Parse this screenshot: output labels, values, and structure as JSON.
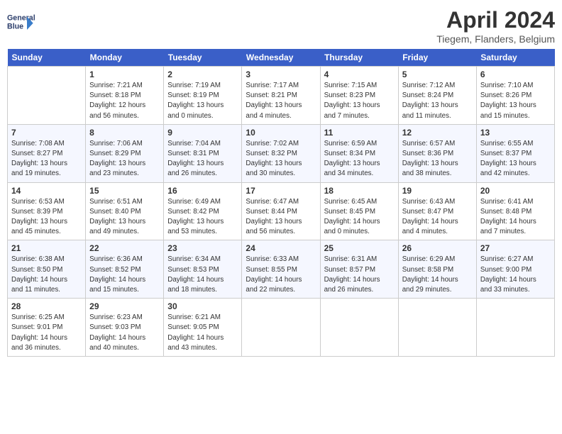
{
  "header": {
    "logo_line1": "General",
    "logo_line2": "Blue",
    "month_title": "April 2024",
    "location": "Tiegem, Flanders, Belgium"
  },
  "weekdays": [
    "Sunday",
    "Monday",
    "Tuesday",
    "Wednesday",
    "Thursday",
    "Friday",
    "Saturday"
  ],
  "weeks": [
    [
      {
        "day": "",
        "info": ""
      },
      {
        "day": "1",
        "info": "Sunrise: 7:21 AM\nSunset: 8:18 PM\nDaylight: 12 hours\nand 56 minutes."
      },
      {
        "day": "2",
        "info": "Sunrise: 7:19 AM\nSunset: 8:19 PM\nDaylight: 13 hours\nand 0 minutes."
      },
      {
        "day": "3",
        "info": "Sunrise: 7:17 AM\nSunset: 8:21 PM\nDaylight: 13 hours\nand 4 minutes."
      },
      {
        "day": "4",
        "info": "Sunrise: 7:15 AM\nSunset: 8:23 PM\nDaylight: 13 hours\nand 7 minutes."
      },
      {
        "day": "5",
        "info": "Sunrise: 7:12 AM\nSunset: 8:24 PM\nDaylight: 13 hours\nand 11 minutes."
      },
      {
        "day": "6",
        "info": "Sunrise: 7:10 AM\nSunset: 8:26 PM\nDaylight: 13 hours\nand 15 minutes."
      }
    ],
    [
      {
        "day": "7",
        "info": "Sunrise: 7:08 AM\nSunset: 8:27 PM\nDaylight: 13 hours\nand 19 minutes."
      },
      {
        "day": "8",
        "info": "Sunrise: 7:06 AM\nSunset: 8:29 PM\nDaylight: 13 hours\nand 23 minutes."
      },
      {
        "day": "9",
        "info": "Sunrise: 7:04 AM\nSunset: 8:31 PM\nDaylight: 13 hours\nand 26 minutes."
      },
      {
        "day": "10",
        "info": "Sunrise: 7:02 AM\nSunset: 8:32 PM\nDaylight: 13 hours\nand 30 minutes."
      },
      {
        "day": "11",
        "info": "Sunrise: 6:59 AM\nSunset: 8:34 PM\nDaylight: 13 hours\nand 34 minutes."
      },
      {
        "day": "12",
        "info": "Sunrise: 6:57 AM\nSunset: 8:36 PM\nDaylight: 13 hours\nand 38 minutes."
      },
      {
        "day": "13",
        "info": "Sunrise: 6:55 AM\nSunset: 8:37 PM\nDaylight: 13 hours\nand 42 minutes."
      }
    ],
    [
      {
        "day": "14",
        "info": "Sunrise: 6:53 AM\nSunset: 8:39 PM\nDaylight: 13 hours\nand 45 minutes."
      },
      {
        "day": "15",
        "info": "Sunrise: 6:51 AM\nSunset: 8:40 PM\nDaylight: 13 hours\nand 49 minutes."
      },
      {
        "day": "16",
        "info": "Sunrise: 6:49 AM\nSunset: 8:42 PM\nDaylight: 13 hours\nand 53 minutes."
      },
      {
        "day": "17",
        "info": "Sunrise: 6:47 AM\nSunset: 8:44 PM\nDaylight: 13 hours\nand 56 minutes."
      },
      {
        "day": "18",
        "info": "Sunrise: 6:45 AM\nSunset: 8:45 PM\nDaylight: 14 hours\nand 0 minutes."
      },
      {
        "day": "19",
        "info": "Sunrise: 6:43 AM\nSunset: 8:47 PM\nDaylight: 14 hours\nand 4 minutes."
      },
      {
        "day": "20",
        "info": "Sunrise: 6:41 AM\nSunset: 8:48 PM\nDaylight: 14 hours\nand 7 minutes."
      }
    ],
    [
      {
        "day": "21",
        "info": "Sunrise: 6:38 AM\nSunset: 8:50 PM\nDaylight: 14 hours\nand 11 minutes."
      },
      {
        "day": "22",
        "info": "Sunrise: 6:36 AM\nSunset: 8:52 PM\nDaylight: 14 hours\nand 15 minutes."
      },
      {
        "day": "23",
        "info": "Sunrise: 6:34 AM\nSunset: 8:53 PM\nDaylight: 14 hours\nand 18 minutes."
      },
      {
        "day": "24",
        "info": "Sunrise: 6:33 AM\nSunset: 8:55 PM\nDaylight: 14 hours\nand 22 minutes."
      },
      {
        "day": "25",
        "info": "Sunrise: 6:31 AM\nSunset: 8:57 PM\nDaylight: 14 hours\nand 26 minutes."
      },
      {
        "day": "26",
        "info": "Sunrise: 6:29 AM\nSunset: 8:58 PM\nDaylight: 14 hours\nand 29 minutes."
      },
      {
        "day": "27",
        "info": "Sunrise: 6:27 AM\nSunset: 9:00 PM\nDaylight: 14 hours\nand 33 minutes."
      }
    ],
    [
      {
        "day": "28",
        "info": "Sunrise: 6:25 AM\nSunset: 9:01 PM\nDaylight: 14 hours\nand 36 minutes."
      },
      {
        "day": "29",
        "info": "Sunrise: 6:23 AM\nSunset: 9:03 PM\nDaylight: 14 hours\nand 40 minutes."
      },
      {
        "day": "30",
        "info": "Sunrise: 6:21 AM\nSunset: 9:05 PM\nDaylight: 14 hours\nand 43 minutes."
      },
      {
        "day": "",
        "info": ""
      },
      {
        "day": "",
        "info": ""
      },
      {
        "day": "",
        "info": ""
      },
      {
        "day": "",
        "info": ""
      }
    ]
  ]
}
